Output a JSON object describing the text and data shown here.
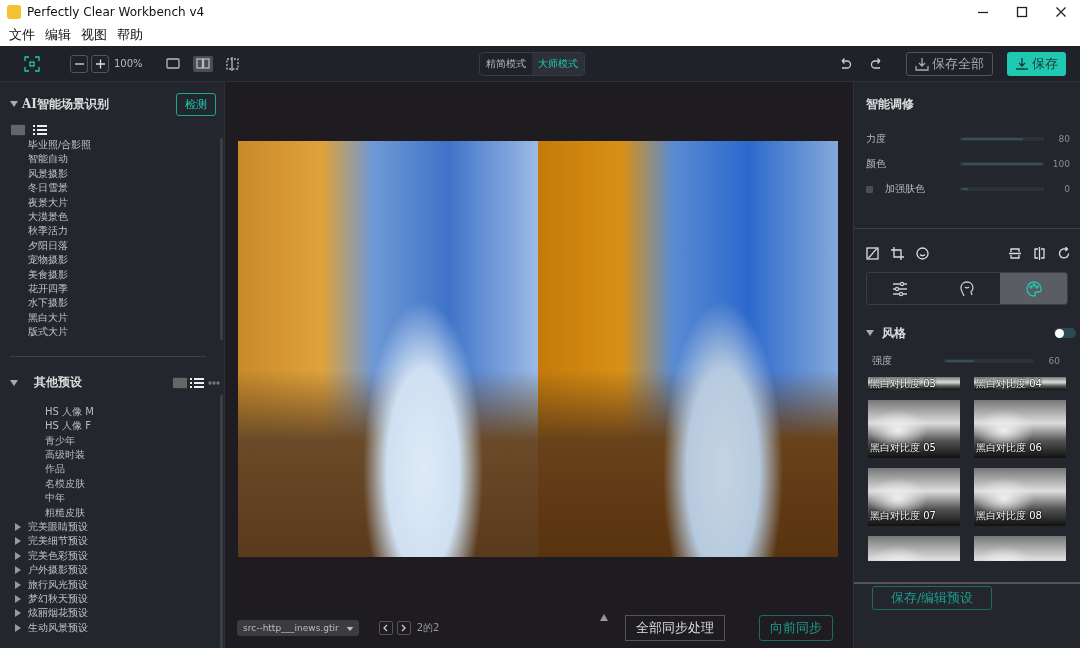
{
  "window": {
    "title": "Perfectly Clear Workbench v4"
  },
  "menu": [
    "文件",
    "编辑",
    "视图",
    "帮助"
  ],
  "toolbar": {
    "zoom": "100%",
    "views": [
      {
        "kind": "single",
        "selected": false
      },
      {
        "kind": "split",
        "selected": true
      },
      {
        "kind": "crop",
        "selected": false
      }
    ],
    "modes": [
      {
        "label": "精简模式",
        "selected": false
      },
      {
        "label": "大师模式",
        "selected": true
      }
    ],
    "save_all": "保存全部",
    "save": "保存"
  },
  "scene_panel": {
    "title": "AI智能场景识别",
    "expanded": true,
    "detect_button": "检测",
    "view_modes": [
      {
        "kind": "grid",
        "selected": false
      },
      {
        "kind": "list",
        "selected": true
      }
    ],
    "items": [
      "毕业照/合影照",
      "智能自动",
      "风景摄影",
      "冬日雪景",
      "夜景大片",
      "大漠景色",
      "秋季活力",
      "夕阳日落",
      "宠物摄影",
      "美食摄影",
      "花开四季",
      "水下摄影",
      "黑白大片",
      "版式大片"
    ]
  },
  "presets_panel": {
    "title": "其他预设",
    "expanded": true,
    "view_modes": [
      {
        "kind": "grid",
        "selected": false
      },
      {
        "kind": "list",
        "selected": true
      }
    ],
    "items": [
      {
        "label": "HS 人像 M",
        "kind": "preset"
      },
      {
        "label": "HS 人像 F",
        "kind": "preset"
      },
      {
        "label": "青少年",
        "kind": "preset"
      },
      {
        "label": "高级时装",
        "kind": "preset"
      },
      {
        "label": "作品",
        "kind": "preset"
      },
      {
        "label": "名模皮肤",
        "kind": "preset"
      },
      {
        "label": "中年",
        "kind": "preset"
      },
      {
        "label": "粗糙皮肤",
        "kind": "preset"
      },
      {
        "label": "完美眼睛预设",
        "kind": "group",
        "expanded": false
      },
      {
        "label": "完美细节预设",
        "kind": "group",
        "expanded": false
      },
      {
        "label": "完美色彩预设",
        "kind": "group",
        "expanded": false
      },
      {
        "label": "户外摄影预设",
        "kind": "group",
        "expanded": false
      },
      {
        "label": "旅行风光预设",
        "kind": "group",
        "expanded": false
      },
      {
        "label": "梦幻秋天预设",
        "kind": "group",
        "expanded": false
      },
      {
        "label": "炫丽烟花预设",
        "kind": "group",
        "expanded": false
      },
      {
        "label": "生动风景预设",
        "kind": "group",
        "expanded": false
      }
    ]
  },
  "viewer": {
    "file": "src--http___inews.gtir",
    "page": "2的2",
    "buttons": [
      {
        "label": "全部同步处理",
        "kind": "secondary"
      },
      {
        "label": "向前同步",
        "kind": "primary"
      }
    ]
  },
  "adjust_panel": {
    "title": "智能调修",
    "sliders": [
      {
        "kind": "slider",
        "label": "力度",
        "level": 0.76,
        "reading": "80"
      },
      {
        "kind": "slider",
        "label": "颜色",
        "level": 1,
        "reading": "100"
      },
      {
        "kind": "checkbox",
        "label": "加强肤色",
        "checked": false,
        "level": 0.08,
        "reading": "0"
      }
    ],
    "tool_tabs": [
      {
        "kind": "sliders",
        "selected": false
      },
      {
        "kind": "face",
        "selected": false
      },
      {
        "kind": "palette",
        "selected": true
      }
    ],
    "style_section": {
      "title": "风格",
      "expanded": true,
      "on": false,
      "strength": {
        "label": "强度",
        "level": 0.32,
        "reading": "60"
      },
      "thumbnails": [
        {
          "kind": "partial",
          "label": "黑白对比度 03"
        },
        {
          "kind": "partial",
          "label": "黑白对比度 04"
        },
        {
          "kind": "labeled",
          "label": "黑白对比度 05"
        },
        {
          "kind": "labeled",
          "label": "黑白对比度 06"
        },
        {
          "kind": "labeled",
          "label": "黑白对比度 07"
        },
        {
          "kind": "labeled",
          "label": "黑白对比度 08"
        },
        {
          "kind": "unlabeled"
        },
        {
          "kind": "unlabeled"
        }
      ]
    },
    "save_preset_button": "保存/编辑预设"
  }
}
